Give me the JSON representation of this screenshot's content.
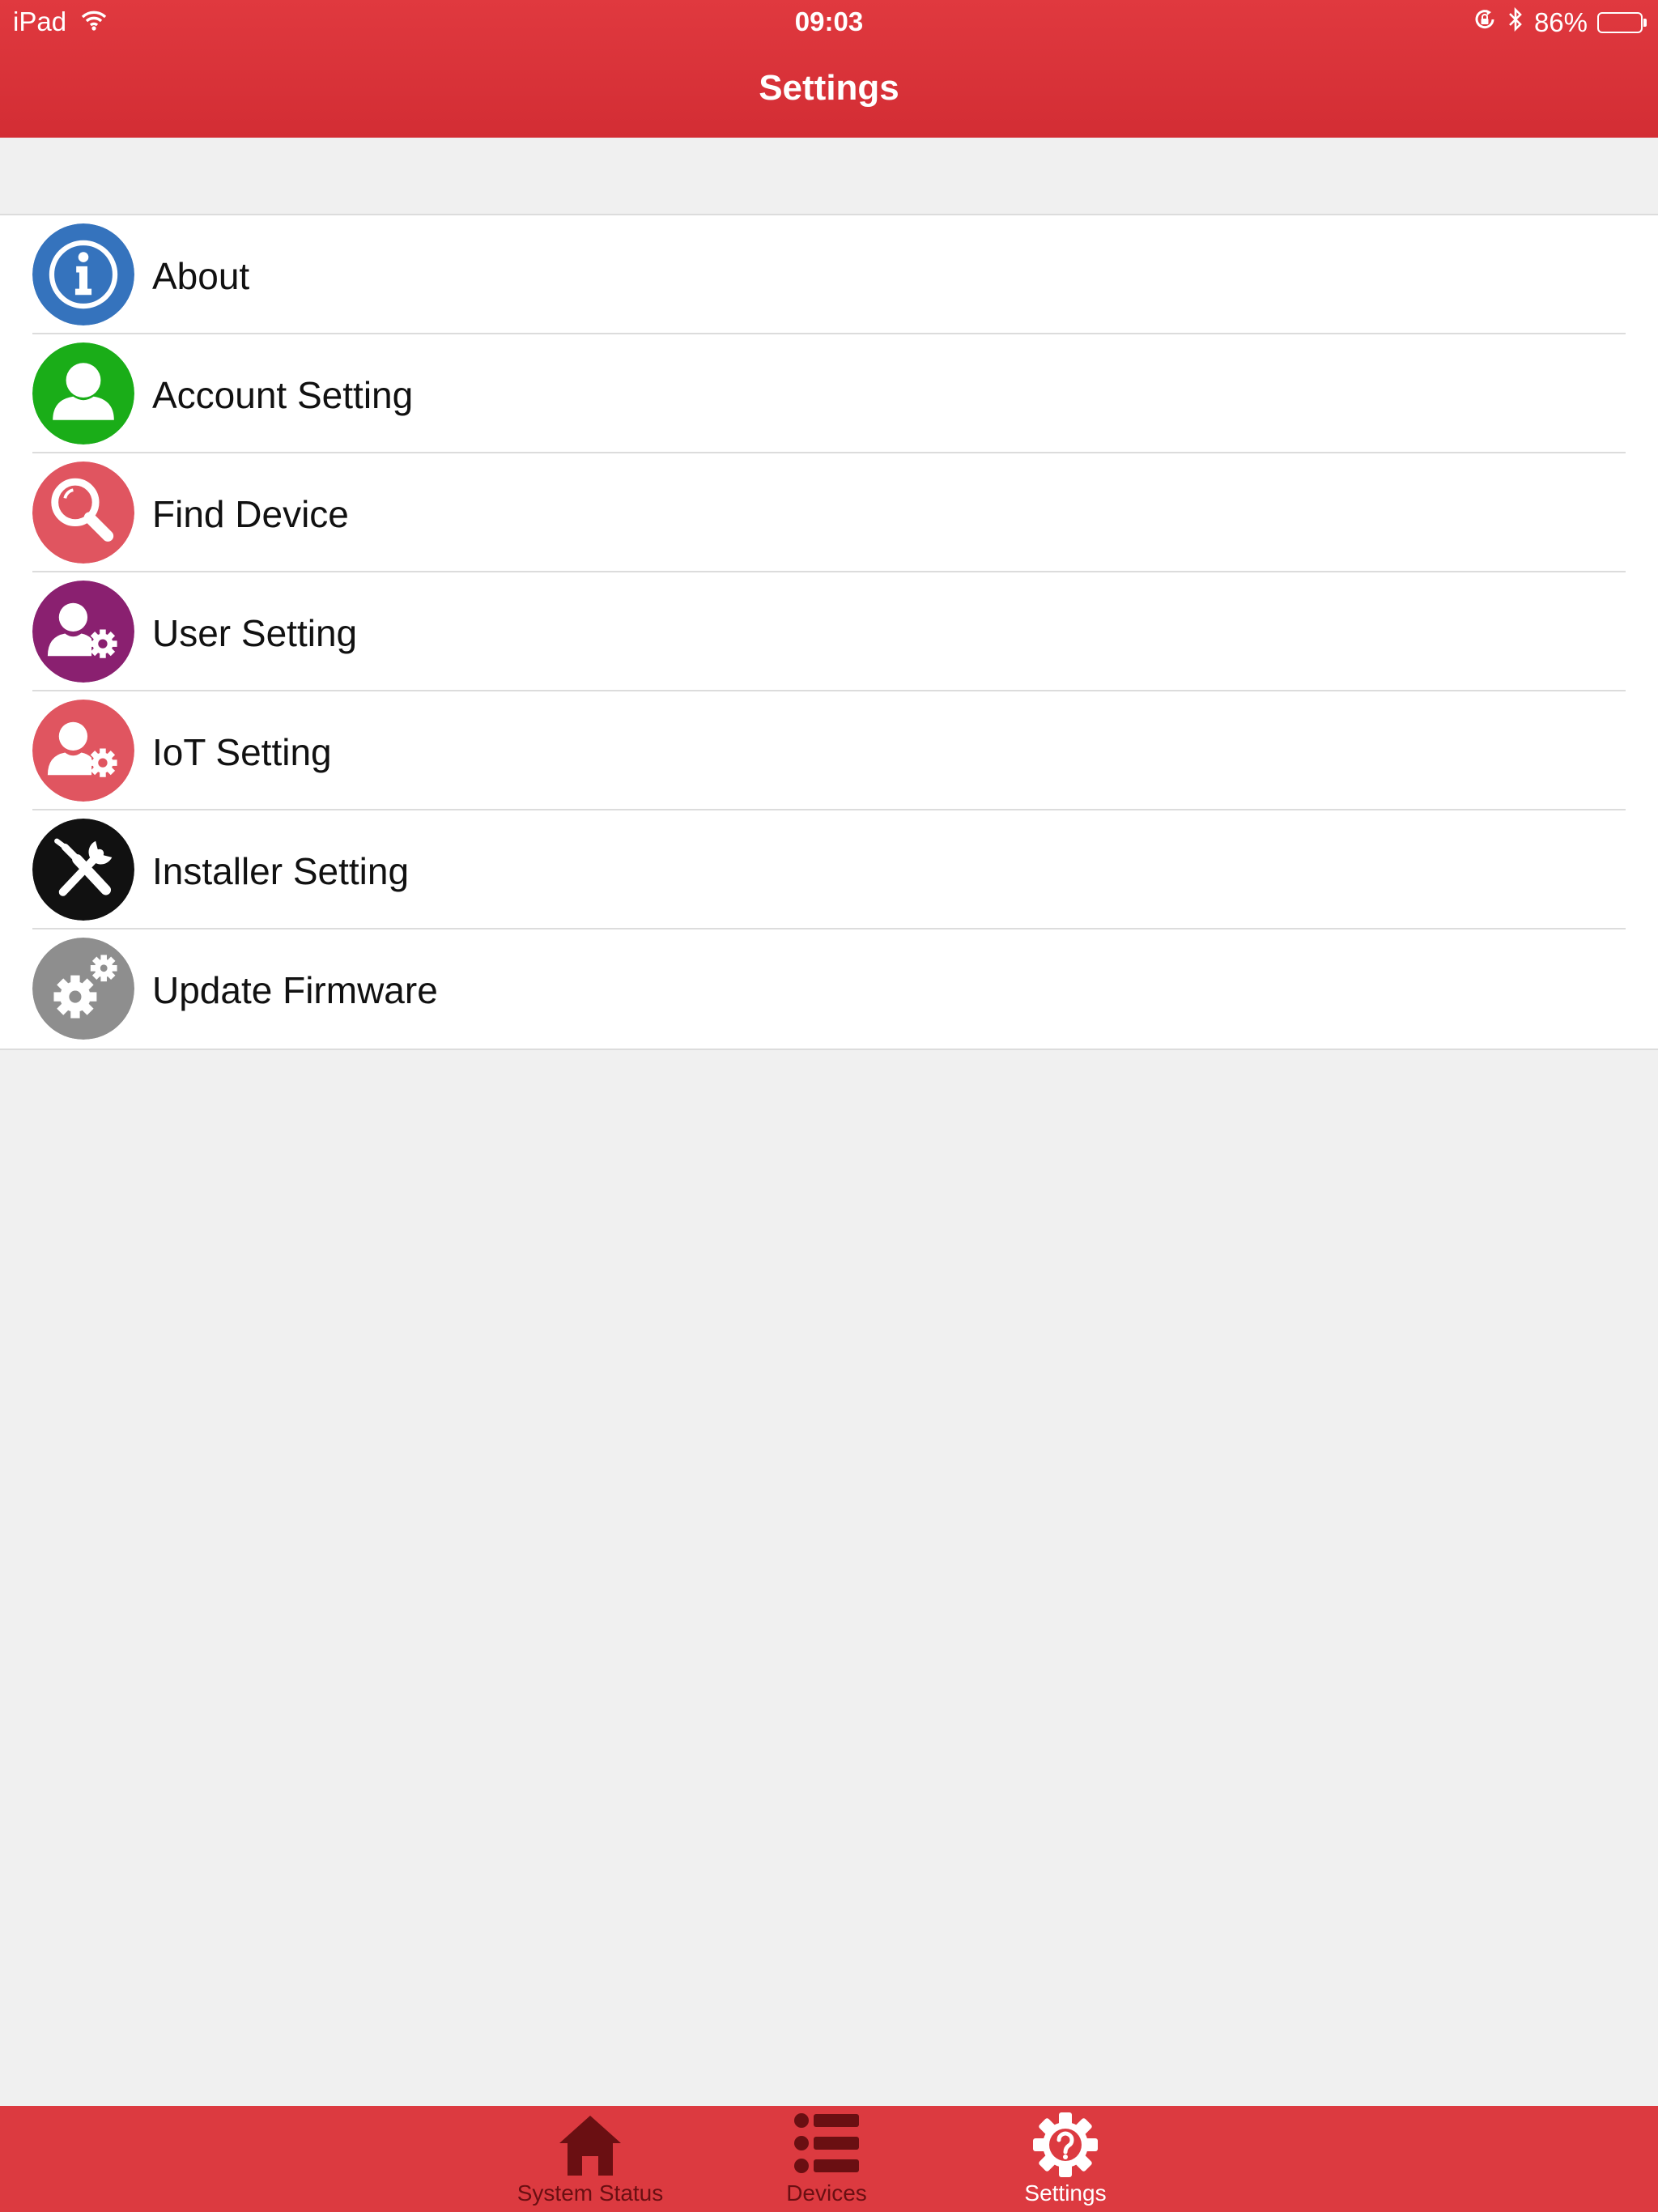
{
  "status_bar": {
    "device": "iPad",
    "time": "09:03",
    "battery_percent": "86%",
    "battery_level": 0.86
  },
  "header": {
    "title": "Settings"
  },
  "menu": [
    {
      "label": "About",
      "icon": "info-icon",
      "color": "#3573bd"
    },
    {
      "label": "Account Setting",
      "icon": "user-icon",
      "color": "#1aad18"
    },
    {
      "label": "Find Device",
      "icon": "magnifier-icon",
      "color": "#e05560"
    },
    {
      "label": "User Setting",
      "icon": "user-gear-icon",
      "color": "#8a2070"
    },
    {
      "label": "IoT Setting",
      "icon": "user-gear-icon",
      "color": "#e05560"
    },
    {
      "label": "Installer Setting",
      "icon": "tools-icon",
      "color": "#111111"
    },
    {
      "label": "Update Firmware",
      "icon": "gears-icon",
      "color": "#8e8e8e"
    }
  ],
  "tabs": [
    {
      "label": "System Status",
      "icon": "home-icon",
      "active": false
    },
    {
      "label": "Devices",
      "icon": "list-icon",
      "active": false
    },
    {
      "label": "Settings",
      "icon": "gear-question-icon",
      "active": true
    }
  ],
  "colors": {
    "primary": "#dc3a40",
    "inactive_tab": "#6a0f12",
    "background": "#f0f0f0"
  }
}
